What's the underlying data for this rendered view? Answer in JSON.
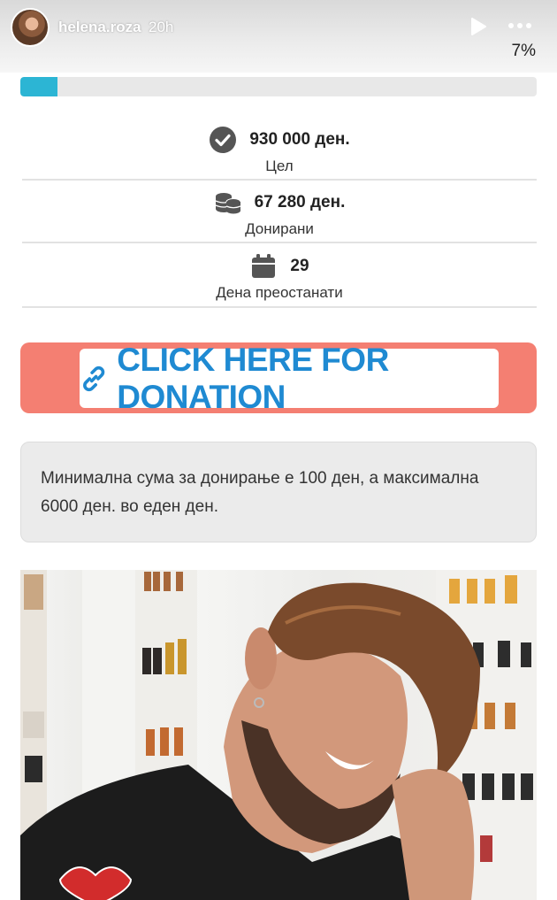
{
  "story": {
    "username": "helena.roza",
    "time": "20h",
    "progress_text": "7%",
    "avatar_icon": "avatar",
    "play_icon": "play-icon",
    "more_icon": "more-icon"
  },
  "campaign": {
    "progress_fraction": 0.072,
    "accent_color": "#2cb5d4",
    "stats": [
      {
        "icon": "checkmark-icon",
        "value": "930 000 ден.",
        "label": "Цел"
      },
      {
        "icon": "coins-icon",
        "value": "67 280 ден.",
        "label": "Донирани"
      },
      {
        "icon": "calendar-icon",
        "value": "29",
        "label": "Дена преостанати"
      }
    ],
    "donation_button": {
      "icon": "link-icon",
      "label": "CLICK HERE FOR DONATION",
      "bg_color": "#f47f72",
      "text_color": "#1f8ad2"
    },
    "notice": "Минимална сума за донирање е 100 ден, а максимална 6000 ден. во еден ден."
  }
}
